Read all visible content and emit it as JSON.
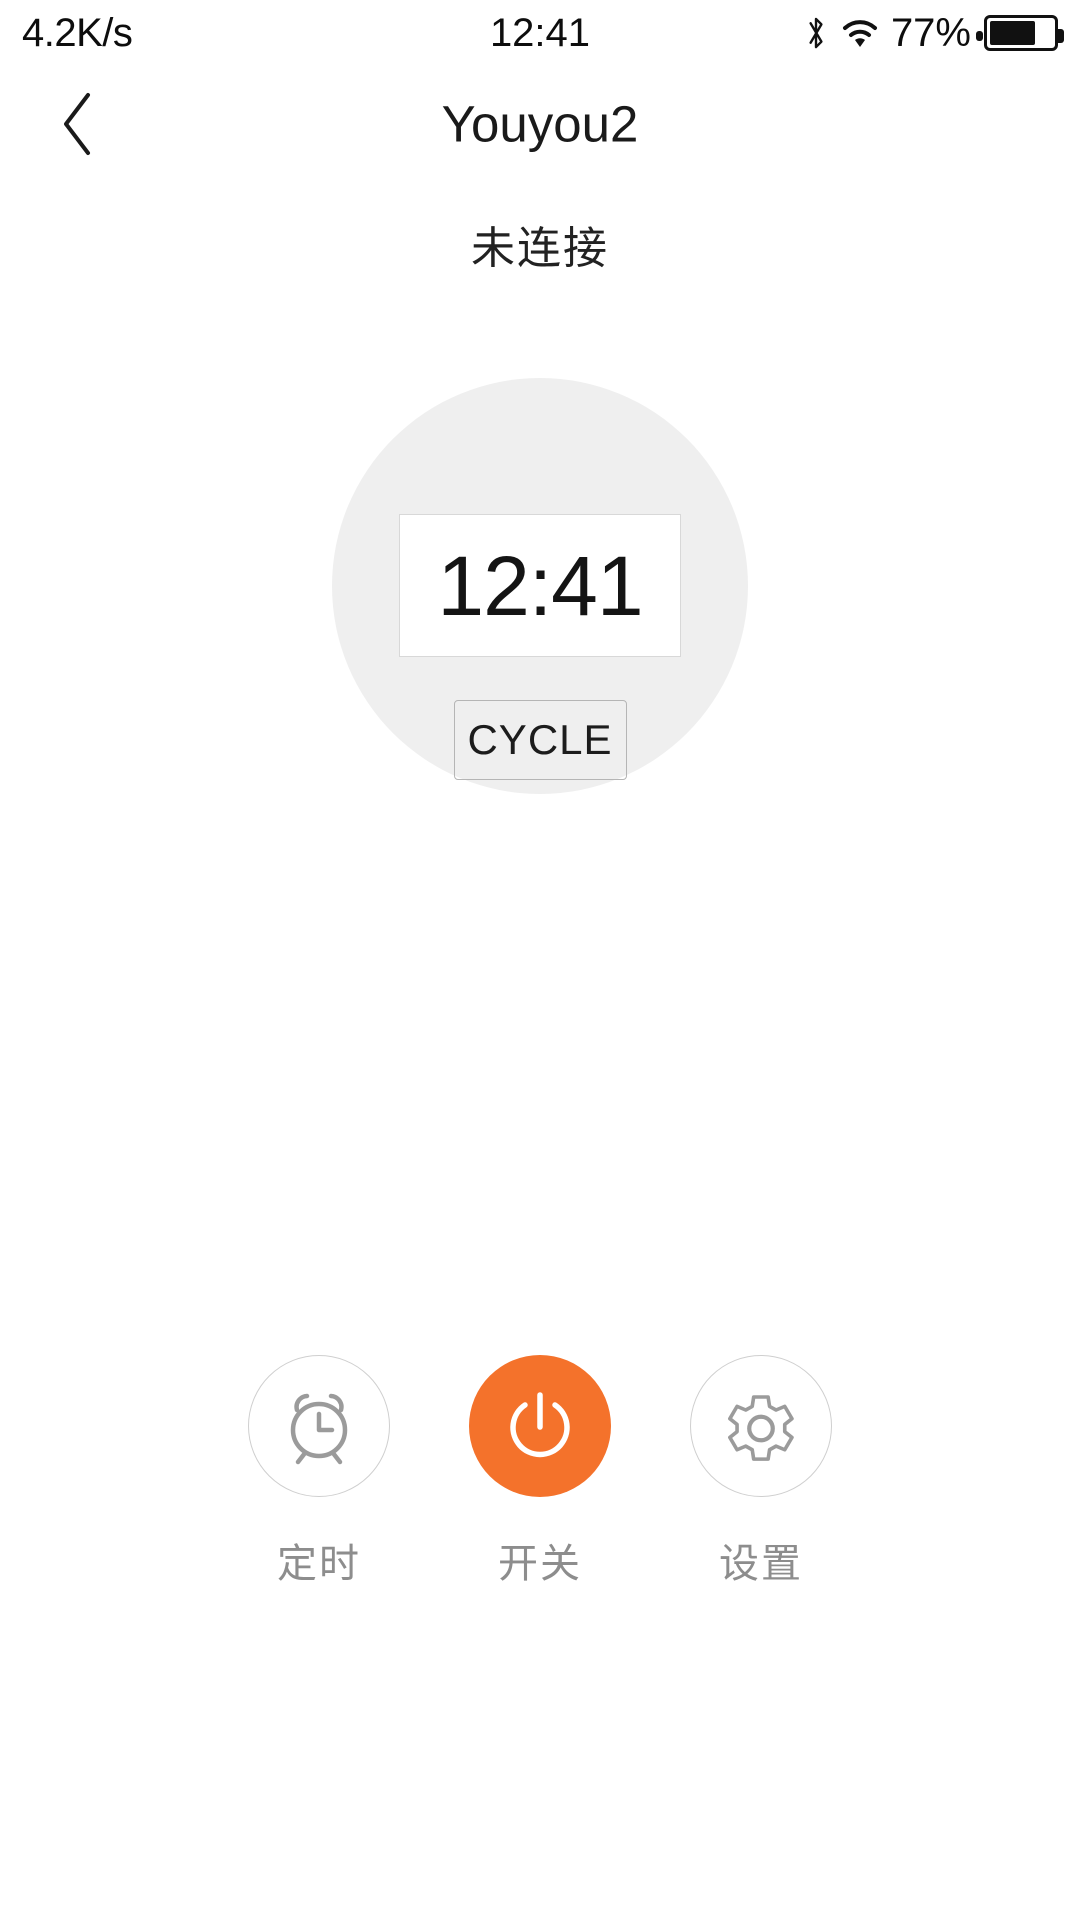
{
  "statusbar": {
    "network_speed": "4.2K/s",
    "clock": "12:41",
    "battery_percent": "77%",
    "bluetooth_icon": "bluetooth-icon",
    "wifi_icon": "wifi-icon",
    "battery_icon": "battery-icon",
    "battery_level": 77
  },
  "navbar": {
    "back_icon": "chevron-left-icon",
    "title": "Youyou2"
  },
  "device": {
    "connection_status": "未连接",
    "dial": {
      "time_value": "12:41",
      "mode_button_label": "CYCLE",
      "dial_bg_color": "#efefef"
    }
  },
  "actions": [
    {
      "label": "定时",
      "icon": "alarm-clock-icon",
      "style": "outline"
    },
    {
      "label": "开关",
      "icon": "power-icon",
      "style": "filled"
    },
    {
      "label": "设置",
      "icon": "gear-icon",
      "style": "outline"
    }
  ],
  "colors": {
    "accent": "#F4722B",
    "icon_gray": "#9b9b9b",
    "label_gray": "#8d8d8d",
    "dial_gray": "#efefef"
  }
}
